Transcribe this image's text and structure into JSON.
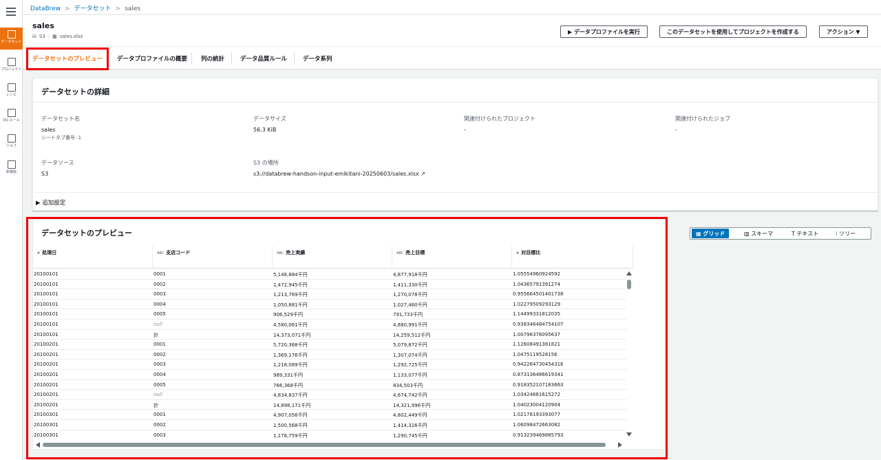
{
  "breadcrumb": {
    "root": "DataBrew",
    "datasets": "データセット",
    "current": "sales"
  },
  "nav": {
    "items": [
      {
        "label": "データセット",
        "icon": "grid-icon"
      },
      {
        "label": "プロジェクト",
        "icon": "table-icon"
      },
      {
        "label": "レシピ",
        "icon": "list-icon"
      },
      {
        "label": "DQ ルール",
        "icon": "rule-icon"
      },
      {
        "label": "ジョブ",
        "icon": "play-icon"
      },
      {
        "label": "新機能",
        "icon": "news-icon"
      }
    ]
  },
  "header": {
    "title": "sales",
    "source": "S3",
    "file": "sales.xlsx",
    "run_profile": "データプロファイルを実行",
    "create_project": "このデータセットを使用してプロジェクトを作成する",
    "actions": "アクション"
  },
  "tabs": [
    "データセットのプレビュー",
    "データプロファイルの概要",
    "列の統計",
    "データ品質ルール",
    "データ系列"
  ],
  "details": {
    "title": "データセットの詳細",
    "name_k": "データセット名",
    "name_v": "sales",
    "sheet": "シートタブ番号: 1",
    "size_k": "データサイズ",
    "size_v": "56.3 KiB",
    "proj_k": "関連付けられたプロジェクト",
    "proj_v": "-",
    "job_k": "関連付けられたジョブ",
    "job_v": "-",
    "src_k": "データソース",
    "src_v": "S3",
    "loc_k": "S3 の場所",
    "loc_v": "s3://databrew-handson-input-emikitani-20250603/sales.xlsx",
    "additional": "追加設定"
  },
  "preview": {
    "title": "データセットのプレビュー",
    "views": [
      "グリッド",
      "スキーマ",
      "テキスト",
      "ツリー"
    ]
  },
  "table": {
    "columns": [
      {
        "type": "#",
        "name": "処理日"
      },
      {
        "type": "ABC",
        "name": "支店コード"
      },
      {
        "type": "ABC",
        "name": "売上実績"
      },
      {
        "type": "ABC",
        "name": "売上目標"
      },
      {
        "type": "#",
        "name": "対目標比"
      }
    ],
    "rows": [
      [
        "20100101",
        "0001",
        "5,148,884千円",
        "4,877,918千円",
        "1.05554960924592"
      ],
      [
        "20100101",
        "0002",
        "1,472,945千円",
        "1,411,330千円",
        "1.04365791391274"
      ],
      [
        "20100101",
        "0003",
        "1,213,769千円",
        "1,270,078千円",
        "0.955664501401738"
      ],
      [
        "20100101",
        "0004",
        "1,050,881千円",
        "1,027,460千円",
        "1.02279509293129"
      ],
      [
        "20100101",
        "0005",
        "906,529千円",
        "791,733千円",
        "1.14499331812035"
      ],
      [
        "20100101",
        "null",
        "4,580,061千円",
        "4,880,991千円",
        "0.938346484754107"
      ],
      [
        "20100101",
        "計",
        "14,373,071千円",
        "14,259,512千円",
        "1.00796376095637"
      ],
      [
        "20100201",
        "0001",
        "5,720,368千円",
        "5,079,872千円",
        "1.12608491381821"
      ],
      [
        "20100201",
        "0002",
        "1,369,176千円",
        "1,307,074千円",
        "1.0475119528156"
      ],
      [
        "20100201",
        "0003",
        "1,218,089千円",
        "1,292,725千円",
        "0.942264730454316"
      ],
      [
        "20100201",
        "0004",
        "989,331千円",
        "1,133,077千円",
        "0.873136486619341"
      ],
      [
        "20100201",
        "0005",
        "766,368千円",
        "834,503千円",
        "0.918352107183663"
      ],
      [
        "20100201",
        "null",
        "4,834,837千円",
        "4,674,742千円",
        "1.03424681615272"
      ],
      [
        "20100201",
        "計",
        "14,898,171千円",
        "14,321,996千円",
        "1.04023004120904"
      ],
      [
        "20100301",
        "0001",
        "4,907,056千円",
        "4,802,449千円",
        "1.02178193393077"
      ],
      [
        "20100301",
        "0002",
        "1,500,568千円",
        "1,414,316千円",
        "1.06098472663082"
      ],
      [
        "20100301",
        "0003",
        "1,178,759千円",
        "1,290,745千円",
        "0.913239469885793"
      ]
    ]
  }
}
